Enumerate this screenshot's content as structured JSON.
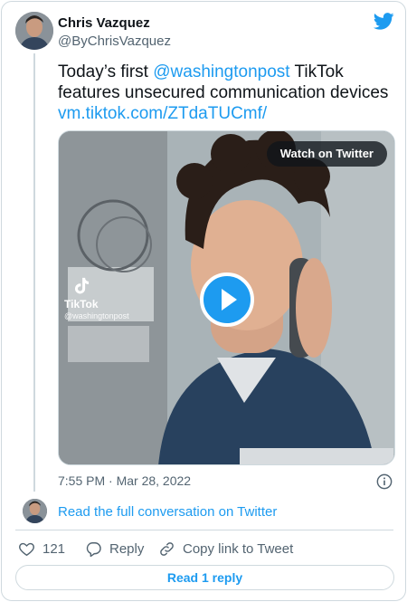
{
  "author": {
    "name": "Chris Vazquez",
    "handle": "@ByChrisVazquez"
  },
  "tweet": {
    "text_before_mention": "Today’s first ",
    "mention": "@washingtonpost",
    "text_after_mention": " TikTok features unsecured communication devices",
    "link": "vm.tiktok.com/ZTdaTUCmf/"
  },
  "media": {
    "watch_label": "Watch on Twitter",
    "tiktok_label": "TikTok",
    "tiktok_handle": "@washingtonpost"
  },
  "timestamp": "7:55 PM · Mar 28, 2022",
  "conversation_link": "Read the full conversation on Twitter",
  "actions": {
    "like_count": "121",
    "reply_label": "Reply",
    "copy_label": "Copy link to Tweet"
  },
  "read_replies_label": "Read 1 reply",
  "colors": {
    "accent": "#1d9bf0",
    "text": "#0f1419",
    "muted": "#536471",
    "border": "#cfd9de"
  },
  "icons": {
    "brand": "twitter-bird-icon",
    "play": "play-icon",
    "info": "info-icon",
    "like": "heart-icon",
    "reply": "speech-bubble-icon",
    "copy": "link-icon",
    "tiktok": "tiktok-icon"
  }
}
